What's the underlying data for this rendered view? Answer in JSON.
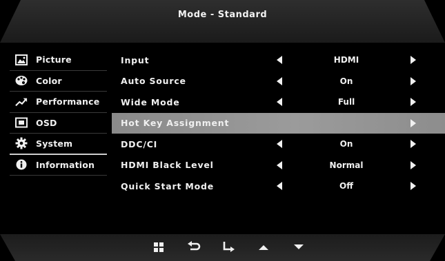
{
  "header": {
    "title": "Mode - Standard"
  },
  "sidebar": {
    "items": [
      {
        "label": "Picture",
        "icon": "picture-icon"
      },
      {
        "label": "Color",
        "icon": "palette-icon"
      },
      {
        "label": "Performance",
        "icon": "performance-icon"
      },
      {
        "label": "OSD",
        "icon": "osd-icon"
      },
      {
        "label": "System",
        "icon": "gear-icon",
        "active": true
      },
      {
        "label": "Information",
        "icon": "info-icon"
      }
    ]
  },
  "settings": {
    "rows": [
      {
        "label": "Input",
        "value": "HDMI"
      },
      {
        "label": "Auto Source",
        "value": "On"
      },
      {
        "label": "Wide Mode",
        "value": "Full"
      },
      {
        "label": "Hot Key Assignment",
        "value": "",
        "selected": true
      },
      {
        "label": "DDC/CI",
        "value": "On"
      },
      {
        "label": "HDMI Black Level",
        "value": "Normal"
      },
      {
        "label": "Quick Start Mode",
        "value": "Off"
      }
    ]
  },
  "nav": {
    "buttons": [
      "menu-grid-icon",
      "back-icon",
      "enter-icon",
      "up-arrow-icon",
      "down-arrow-icon"
    ]
  },
  "colors": {
    "background": "#000000",
    "text": "#f0f0f0",
    "highlight": "#9a9a9a"
  }
}
